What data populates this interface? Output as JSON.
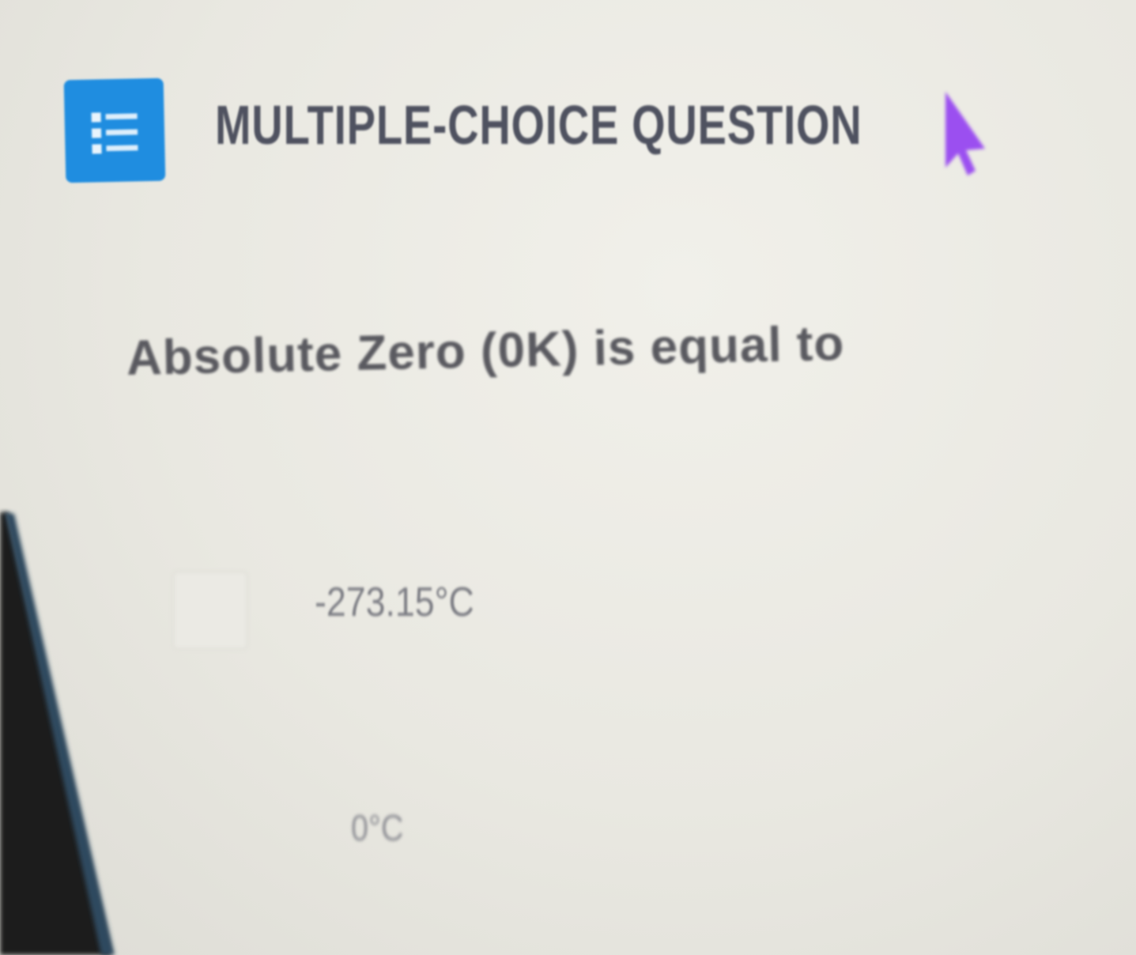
{
  "header": {
    "icon": "list-checklist-icon",
    "title": "MULTIPLE-CHOICE QUESTION"
  },
  "question": {
    "text": "Absolute Zero (0K) is equal to"
  },
  "options": [
    {
      "label": "-273.15°C",
      "checked": false
    },
    {
      "label": "0°C",
      "checked": false
    }
  ],
  "colors": {
    "accent": "#1f8de0",
    "cursor": "#9b4ff0",
    "text_dark": "#4f5260",
    "text_muted": "#7c7d84",
    "background": "#ecebe5"
  }
}
